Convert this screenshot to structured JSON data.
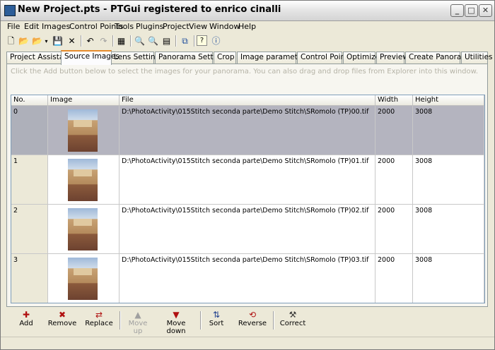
{
  "window": {
    "title": "New Project.pts - PTGui registered to enrico cinalli",
    "minimize": "_",
    "maximize": "□",
    "close": "✕"
  },
  "menu": [
    "File",
    "Edit",
    "Images",
    "Control Points",
    "Tools",
    "Plugins",
    "Project",
    "View",
    "Window",
    "Help"
  ],
  "toolbar": {
    "icons": [
      "new-icon",
      "open-icon",
      "open-recent-icon",
      "save-icon",
      "close-project-icon",
      "undo-icon",
      "redo-icon",
      "project-settings-icon",
      "zoom-in-icon",
      "zoom-out-icon",
      "table-icon",
      "windows-icon",
      "help-icon",
      "info-icon"
    ]
  },
  "tabs": [
    "Project Assistant",
    "Source Images",
    "Lens Settings",
    "Panorama Settings",
    "Crop",
    "Image parameters",
    "Control Points",
    "Optimizer",
    "Preview",
    "Create Panorama",
    "Utilities"
  ],
  "hint": "Click the Add button below to select the images for your panorama. You can also drag and drop files from Explorer into this window.",
  "table": {
    "columns": [
      "No.",
      "Image",
      "File",
      "Width",
      "Height"
    ],
    "rows": [
      {
        "no": "0",
        "file": "D:\\PhotoActivity\\015Stitch seconda parte\\Demo Stitch\\SRomolo (TP)00.tif",
        "width": "2000",
        "height": "3008"
      },
      {
        "no": "1",
        "file": "D:\\PhotoActivity\\015Stitch seconda parte\\Demo Stitch\\SRomolo (TP)01.tif",
        "width": "2000",
        "height": "3008"
      },
      {
        "no": "2",
        "file": "D:\\PhotoActivity\\015Stitch seconda parte\\Demo Stitch\\SRomolo (TP)02.tif",
        "width": "2000",
        "height": "3008"
      },
      {
        "no": "3",
        "file": "D:\\PhotoActivity\\015Stitch seconda parte\\Demo Stitch\\SRomolo (TP)03.tif",
        "width": "2000",
        "height": "3008"
      }
    ]
  },
  "buttons": {
    "add": "Add",
    "remove": "Remove",
    "replace": "Replace",
    "move_up": "Move up",
    "move_down": "Move down",
    "sort": "Sort",
    "reverse": "Reverse",
    "correct": "Correct"
  }
}
